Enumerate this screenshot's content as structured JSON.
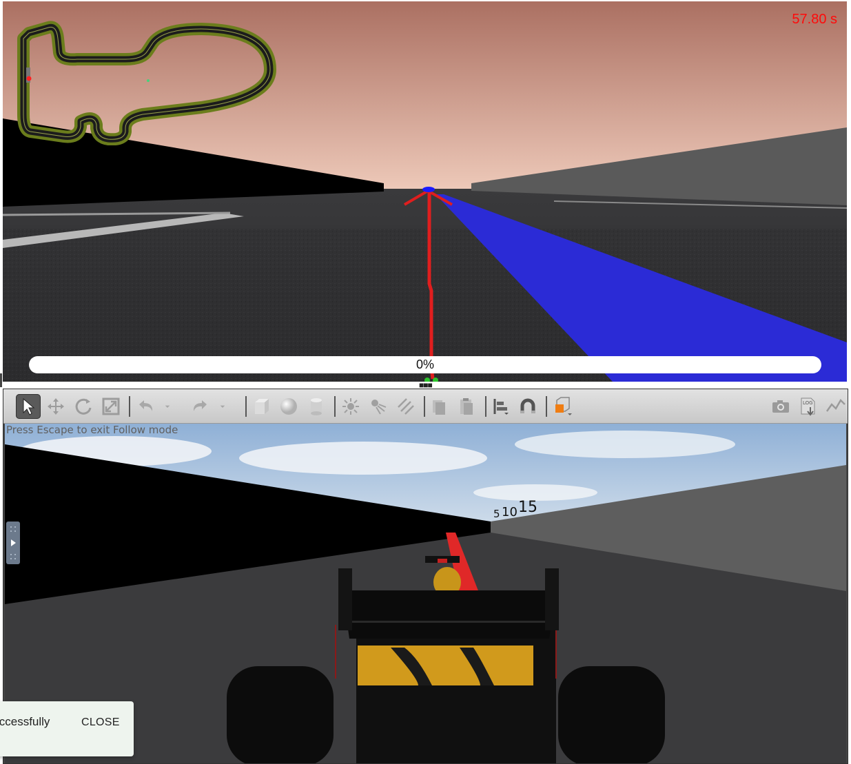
{
  "top_view": {
    "timer": "57.80 s",
    "progress": {
      "value_percent": 0,
      "label": "0%"
    }
  },
  "toolbar": {
    "left_icons": [
      "select-arrow-icon",
      "translate-icon",
      "rotate-icon",
      "scale-icon",
      "undo-icon",
      "undo-dropdown-icon",
      "redo-icon",
      "redo-dropdown-icon",
      "box-shape-icon",
      "sphere-shape-icon",
      "cylinder-shape-icon",
      "point-light-icon",
      "spot-light-icon",
      "directional-light-icon",
      "copy-icon",
      "paste-icon",
      "align-icon",
      "snap-magnet-icon",
      "view-angle-icon"
    ],
    "right_icons": [
      "screenshot-camera-icon",
      "log-icon",
      "plot-icon"
    ],
    "log_icon_text": "LOG"
  },
  "viewport": {
    "follow_hint": "Press Escape to exit Follow mode",
    "distance_markers": [
      "5",
      "10",
      "15"
    ]
  },
  "snackbar": {
    "message": "ccessfully.",
    "close_label": "CLOSE"
  },
  "colors": {
    "timer": "#ff0a0a",
    "path_line": "#e01e1e",
    "blue_lane": "#2b2bd6",
    "sky_top": "#b0776a",
    "sky_bottom": "#e8c2b2",
    "track_surface": "#2e2e30",
    "left_wall": "#000000",
    "right_wall": "#5c5c5c",
    "view_angle_orange": "#f07d12"
  }
}
